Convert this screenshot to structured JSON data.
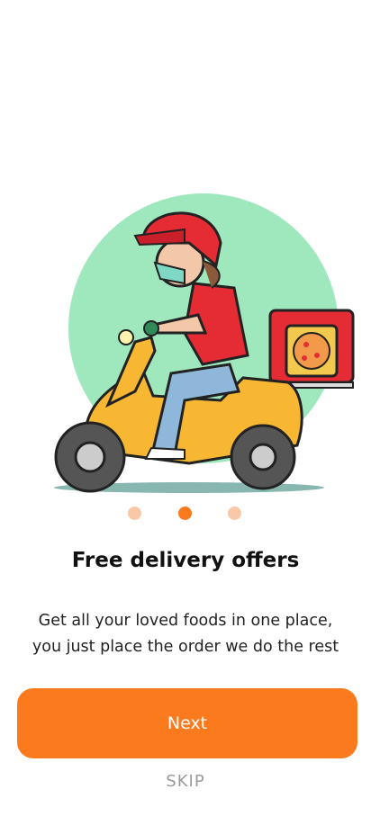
{
  "onboarding": {
    "illustration_icon": "delivery-scooter-rider-icon",
    "title": "Free delivery offers",
    "description": "Get all your loved foods in one place, you just place the order we do the rest",
    "next_label": "Next",
    "skip_label": "SKIP",
    "pager": {
      "count": 3,
      "active_index": 1
    }
  },
  "colors": {
    "accent": "#FC7A1E",
    "dot_inactive": "#F9C9A7",
    "circle_bg": "#9FE7BD",
    "helmet": "#E52B34",
    "scooter": "#F7B733"
  }
}
